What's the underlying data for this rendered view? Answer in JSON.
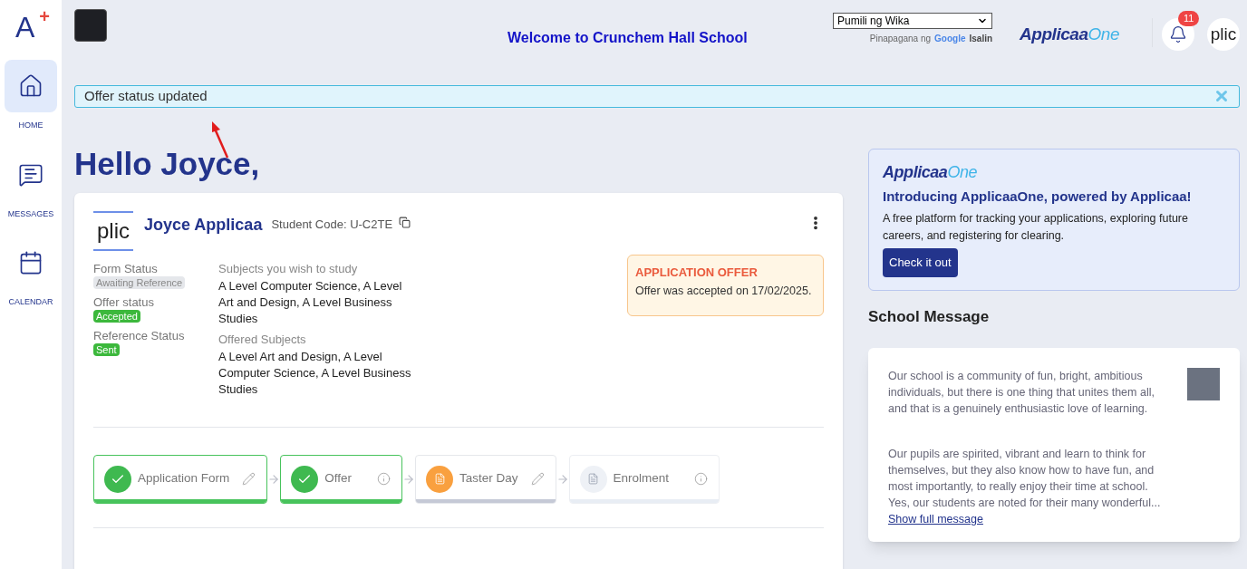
{
  "sidebar": {
    "logo": {
      "letter": "A",
      "mark": "+"
    },
    "items": [
      {
        "label": "HOME",
        "selected": true
      },
      {
        "label": "MESSAGES",
        "selected": false
      },
      {
        "label": "CALENDAR",
        "selected": false
      }
    ]
  },
  "header": {
    "title": "Welcome to Crunchem Hall School",
    "language_select": {
      "value": "Pumili ng Wika"
    },
    "translate_credit": {
      "prefix": "Pinapagana ng",
      "brand": "Google",
      "link": "Isalin"
    },
    "brand": {
      "first": "Applicaa",
      "second": "One"
    },
    "notifications": {
      "count": "11"
    },
    "avatar_text": "plic"
  },
  "alert": {
    "message": "Offer status updated"
  },
  "greeting": "Hello Joyce,",
  "student_card": {
    "avatar_text": "plic",
    "name": "Joyce Applicaa",
    "student_code": "Student Code: U-C2TE",
    "statuses": [
      {
        "label": "Form Status",
        "badge": "Awaiting Reference",
        "color": "#e5e7eb"
      },
      {
        "label": "Offer status",
        "badge": "Accepted",
        "color": "#3cb83c"
      },
      {
        "label": "Reference Status",
        "badge": "Sent",
        "color": "#3cb83c"
      }
    ],
    "subjects": [
      {
        "label": "Subjects you wish to study",
        "value": "A Level Computer Science, A Level Art and Design, A Level Business Studies"
      },
      {
        "label": "Offered Subjects",
        "value": "A Level Art and Design, A Level Computer Science, A Level Business Studies"
      }
    ],
    "offer_notice": {
      "title": "APPLICATION OFFER",
      "text": "Offer was accepted on 17/02/2025."
    },
    "steps": [
      {
        "label": "Application Form",
        "kind": "done",
        "editable": true
      },
      {
        "label": "Offer",
        "kind": "done",
        "editable": false
      },
      {
        "label": "Taster Day",
        "kind": "pending",
        "editable": true
      },
      {
        "label": "Enrolment",
        "kind": "locked",
        "editable": false
      }
    ]
  },
  "promo": {
    "brand": {
      "first": "Applicaa",
      "second": "One"
    },
    "title": "Introducing ApplicaaOne, powered by Applicaa!",
    "text": "A free platform for tracking your applications, exploring future careers, and registering for clearing.",
    "button": "Check it out"
  },
  "school_message": {
    "heading": "School Message",
    "paragraphs": [
      "Our school is a community of fun, bright, ambitious individuals, but there is one thing that unites them all, and that is a genuinely enthusiastic love of learning.",
      "Our pupils are spirited, vibrant and learn to think for themselves, but they also know how to have fun, and most importantly, to really enjoy their time at school. Yes, our students are noted for their many wonderful..."
    ],
    "link": "Show full message"
  }
}
